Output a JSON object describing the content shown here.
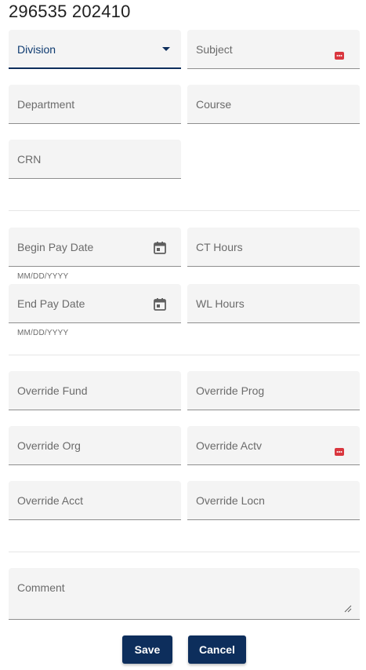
{
  "page_title": "296535 202410",
  "fields": {
    "division": {
      "label": "Division"
    },
    "subject": {
      "label": "Subject"
    },
    "department": {
      "label": "Department"
    },
    "course": {
      "label": "Course"
    },
    "crn": {
      "label": "CRN"
    },
    "begin_pay_date": {
      "label": "Begin Pay Date",
      "hint": "MM/DD/YYYY"
    },
    "ct_hours": {
      "label": "CT Hours"
    },
    "end_pay_date": {
      "label": "End Pay Date",
      "hint": "MM/DD/YYYY"
    },
    "wl_hours": {
      "label": "WL Hours"
    },
    "override_fund": {
      "label": "Override Fund"
    },
    "override_prog": {
      "label": "Override Prog"
    },
    "override_org": {
      "label": "Override Org"
    },
    "override_actv": {
      "label": "Override Actv"
    },
    "override_acct": {
      "label": "Override Acct"
    },
    "override_locn": {
      "label": "Override Locn"
    },
    "comment": {
      "label": "Comment"
    }
  },
  "buttons": {
    "save": "Save",
    "cancel": "Cancel"
  },
  "colors": {
    "primary": "#0d2e5c",
    "field_bg": "#f4f4f4",
    "badge": "#d9363e"
  }
}
